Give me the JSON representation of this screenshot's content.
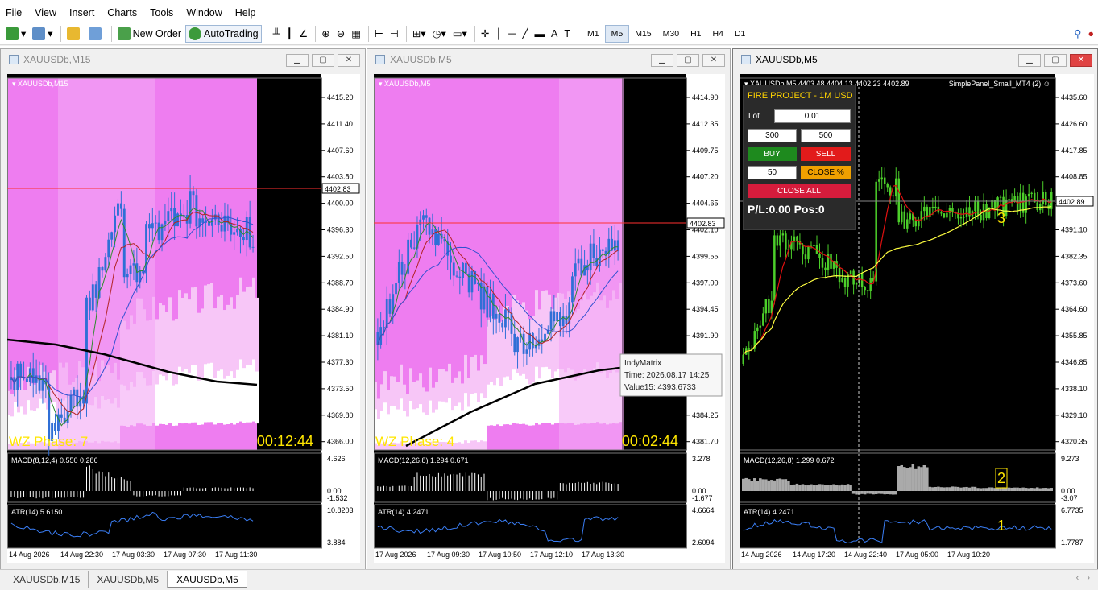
{
  "menu": [
    "File",
    "View",
    "Insert",
    "Charts",
    "Tools",
    "Window",
    "Help"
  ],
  "toolbar": {
    "new_order": "New Order",
    "autotrading": "AutoTrading",
    "timeframes": [
      "M1",
      "M5",
      "M15",
      "M30",
      "H1",
      "H4",
      "D1"
    ],
    "active_timeframe": "M5"
  },
  "windows": [
    {
      "title": "XAUUSDb,M15",
      "symbol_label": "XAUUSDb,M15",
      "price_labels": [
        "4415.20",
        "4411.40",
        "4407.60",
        "4403.80",
        "4400.00",
        "4396.30",
        "4392.50",
        "4388.70",
        "4384.90",
        "4381.10",
        "4377.30",
        "4373.50",
        "4369.80",
        "4366.00"
      ],
      "current_price": "4402.83",
      "phase_text": "WZ Phase: 7",
      "timer": "00:12:44",
      "macd_label": "MACD(8,12,4) 0.550 0.286",
      "macd_scale": [
        "4.626",
        "0.00",
        "-1.532"
      ],
      "atr_label": "ATR(14) 5.6150",
      "atr_scale": [
        "10.8203",
        "3.884"
      ],
      "time_labels": [
        "14 Aug 2026",
        "14 Aug 22:30",
        "17 Aug 03:30",
        "17 Aug 07:30",
        "17 Aug 11:30"
      ]
    },
    {
      "title": "XAUUSDb,M5",
      "symbol_label": "XAUUSDb,M5",
      "price_labels": [
        "4414.90",
        "4412.35",
        "4409.75",
        "4407.20",
        "4404.65",
        "4402.10",
        "4399.55",
        "4397.00",
        "4394.45",
        "4391.90",
        "4389.30",
        "4386.75",
        "4384.25",
        "4381.70"
      ],
      "current_price": "4402.83",
      "phase_text": "WZ Phase: 4",
      "timer": "00:02:44",
      "macd_label": "MACD(12,26,8) 1.294 0.671",
      "macd_scale": [
        "3.278",
        "0.00",
        "-1.677"
      ],
      "atr_label": "ATR(14) 4.2471",
      "atr_scale": [
        "4.6664",
        "2.6094"
      ],
      "time_labels": [
        "17 Aug 2026",
        "17 Aug 09:30",
        "17 Aug 10:50",
        "17 Aug 12:10",
        "17 Aug 13:30"
      ],
      "tooltip": {
        "name": "IndyMatrix",
        "time": "Time: 2026.08.17 14:25",
        "value": "Value15: 4393.6733"
      }
    },
    {
      "title": "XAUUSDb,M5",
      "symbol_label": "XAUUSDb,M5  4403.48 4404.13 4402.23 4402.89",
      "panel_name": "SimplePanel_Small_MT4 (2)",
      "price_labels": [
        "4435.60",
        "4426.60",
        "4417.85",
        "4408.85",
        "4400.10",
        "4391.10",
        "4382.35",
        "4373.60",
        "4364.60",
        "4355.85",
        "4346.85",
        "4338.10",
        "4329.10",
        "4320.35"
      ],
      "current_price": "4402.89",
      "macd_label": "MACD(12,26,8) 1.299 0.672",
      "macd_scale": [
        "9.273",
        "0.00",
        "-3.07"
      ],
      "atr_label": "ATR(14) 4.2471",
      "atr_scale": [
        "6.7735",
        "1.7787"
      ],
      "time_labels": [
        "14 Aug 2026",
        "14 Aug 17:20",
        "14 Aug 22:40",
        "17 Aug 05:00",
        "17 Aug 10:20"
      ],
      "markers": [
        "3",
        "2",
        "1"
      ]
    }
  ],
  "panel": {
    "title": "FIRE PROJECT - 1M USD",
    "lot_label": "Lot",
    "lot_value": "0.01",
    "sl": "300",
    "tp": "500",
    "buy": "BUY",
    "sell": "SELL",
    "close_pct_value": "50",
    "close_pct": "CLOSE %",
    "close_all": "CLOSE ALL",
    "pl": "P/L:0.00 Pos:0"
  },
  "tabs": [
    "XAUUSDb,M15",
    "XAUUSDb,M5",
    "XAUUSDb,M5"
  ],
  "active_tab": 2,
  "colors": {
    "buy": "#1e8a1e",
    "sell": "#e21b1b",
    "close_pct": "#f0a000",
    "close_all": "#d61c3c",
    "candle_bull": "#2f6fd6",
    "candle_green": "#4ccf2a",
    "accent_pink": "#ee7df0"
  }
}
